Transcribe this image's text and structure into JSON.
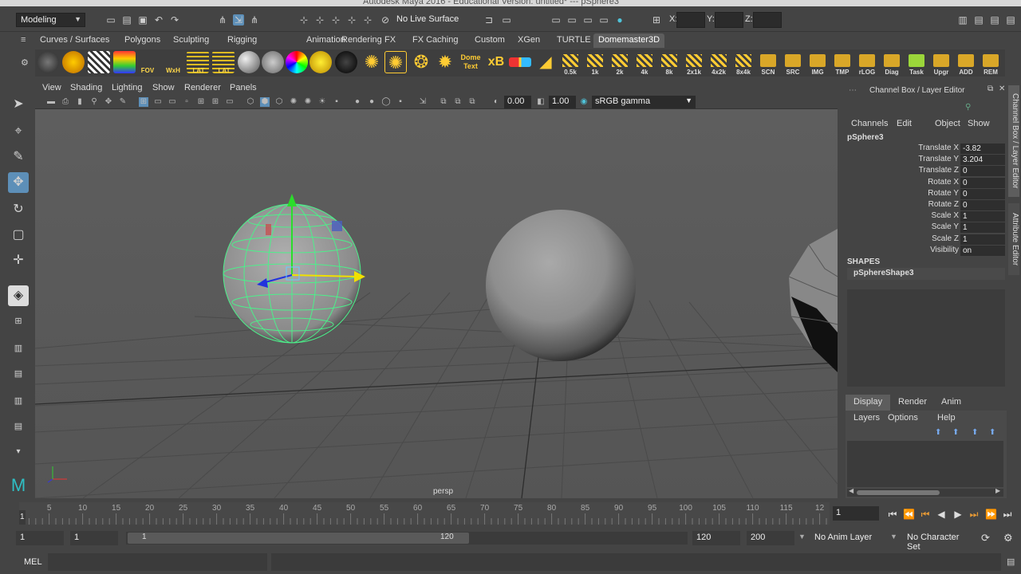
{
  "window": {
    "title": "Autodesk Maya 2016 - Educational Version: untitled*   ---   pSphere3"
  },
  "status_line": {
    "mode": "Modeling",
    "live_surface": "No Live Surface",
    "coords": {
      "x_label": "X:",
      "y_label": "Y:",
      "z_label": "Z:"
    }
  },
  "shelf_tabs": [
    "Curves / Surfaces",
    "Polygons",
    "Sculpting",
    "Rigging",
    "Animation",
    "Rendering",
    "FX",
    "FX Caching",
    "Custom",
    "XGen",
    "TURTLE",
    "Domemaster3D"
  ],
  "shelf_active_tab": "Domemaster3D",
  "shelf_icons": {
    "fov": "FOV",
    "wxh": "WxH",
    "lat1": "LAT",
    "lat2": "LAT",
    "dome_text": "Dome Text",
    "xb": "xB"
  },
  "shelf_labels": [
    "0.5k",
    "1k",
    "2k",
    "4k",
    "8k",
    "2x1k",
    "4x2k",
    "8x4k",
    "SCN",
    "SRC",
    "IMG",
    "TMP",
    "rLOG",
    "Diag",
    "Task",
    "Upgr",
    "ADD",
    "REM"
  ],
  "viewport": {
    "menu": [
      "View",
      "Shading",
      "Lighting",
      "Show",
      "Renderer",
      "Panels"
    ],
    "exposure": "0.00",
    "gamma": "1.00",
    "colorspace": "sRGB gamma",
    "camera_label": "persp"
  },
  "channel_box": {
    "title": "Channel Box / Layer Editor",
    "menu": [
      "Channels",
      "Edit",
      "Object",
      "Show"
    ],
    "object": "pSphere3",
    "channels": [
      {
        "label": "Translate X",
        "value": "-3.82"
      },
      {
        "label": "Translate Y",
        "value": "3.204"
      },
      {
        "label": "Translate Z",
        "value": "0"
      },
      {
        "label": "Rotate X",
        "value": "0"
      },
      {
        "label": "Rotate Y",
        "value": "0"
      },
      {
        "label": "Rotate Z",
        "value": "0"
      },
      {
        "label": "Scale X",
        "value": "1"
      },
      {
        "label": "Scale Y",
        "value": "1"
      },
      {
        "label": "Scale Z",
        "value": "1"
      },
      {
        "label": "Visibility",
        "value": "on"
      }
    ],
    "shapes_header": "SHAPES",
    "shape_name": "pSphereShape3",
    "layer_tabs": [
      "Display",
      "Render",
      "Anim"
    ],
    "layer_menu": [
      "Layers",
      "Options",
      "Help"
    ]
  },
  "side_tabs": [
    "Channel Box / Layer Editor",
    "Attribute Editor"
  ],
  "timeline": {
    "ticks": [
      "5",
      "10",
      "15",
      "20",
      "25",
      "30",
      "35",
      "40",
      "45",
      "50",
      "55",
      "60",
      "65",
      "70",
      "75",
      "80",
      "85",
      "90",
      "95",
      "100",
      "105",
      "110",
      "115",
      "12"
    ],
    "start_marker": "1",
    "current_frame": "1"
  },
  "range": {
    "start": "1",
    "playback_start": "1",
    "slider_start": "1",
    "slider_end": "120",
    "playback_end": "120",
    "end": "200",
    "anim_layer": "No Anim Layer",
    "character_set": "No Character Set"
  },
  "mel": {
    "label": "MEL"
  }
}
